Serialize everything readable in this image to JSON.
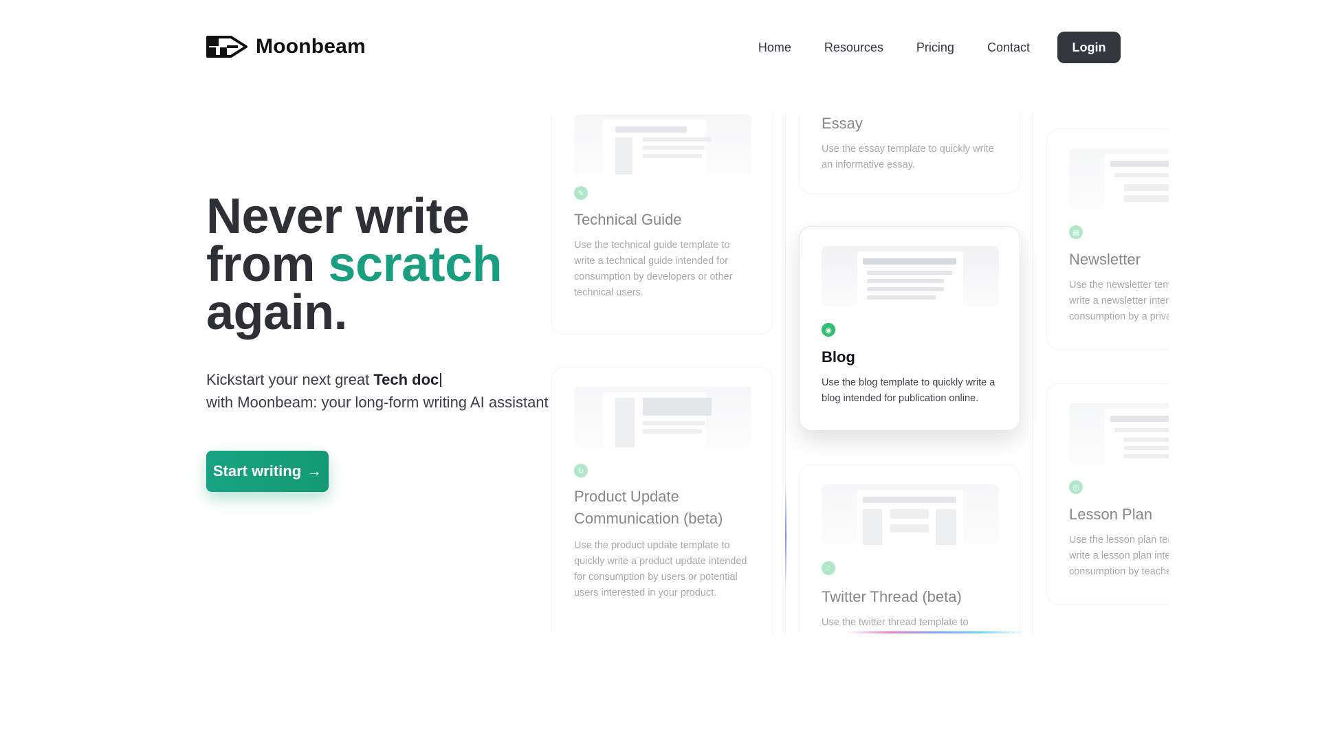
{
  "brand": {
    "name": "Moonbeam"
  },
  "nav": {
    "links": [
      "Home",
      "Resources",
      "Pricing",
      "Contact"
    ],
    "login_label": "Login"
  },
  "hero": {
    "title_line1": "Never write",
    "title_line2_prefix": "from ",
    "title_line2_accent": "scratch",
    "title_line3": "again.",
    "subtitle_prefix": "Kickstart your next great ",
    "subtitle_highlight": "Tech doc",
    "subtitle_line2": "with Moonbeam: your long-form writing AI assistant",
    "cta_label": "Start writing",
    "cta_arrow": "→"
  },
  "templates": [
    {
      "title": "Technical Guide",
      "description": "Use the technical guide template to write a technical guide intended for consumption by developers or other technical users."
    },
    {
      "title": "Product Update Communication (beta)",
      "description": "Use the product update template to quickly write a product update intended for consumption by users or potential users interested in your product."
    },
    {
      "title": "Essay",
      "description": "Use the essay template to quickly write an informative essay."
    },
    {
      "title": "Blog",
      "description": "Use the blog template to quickly write a blog intended for publication online."
    },
    {
      "title": "Twitter Thread (beta)",
      "description": "Use the twitter thread template to"
    },
    {
      "title": "Newsletter",
      "description": "Use the newsletter template to quickly write a newsletter intended for consumption by a private audience."
    },
    {
      "title": "Lesson Plan",
      "description": "Use the lesson plan template to quickly write a lesson plan intended for consumption by teachers or students."
    }
  ],
  "colors": {
    "accent": "#1a9e80",
    "dark_button": "#33363d",
    "badge": "#2fbf71"
  }
}
